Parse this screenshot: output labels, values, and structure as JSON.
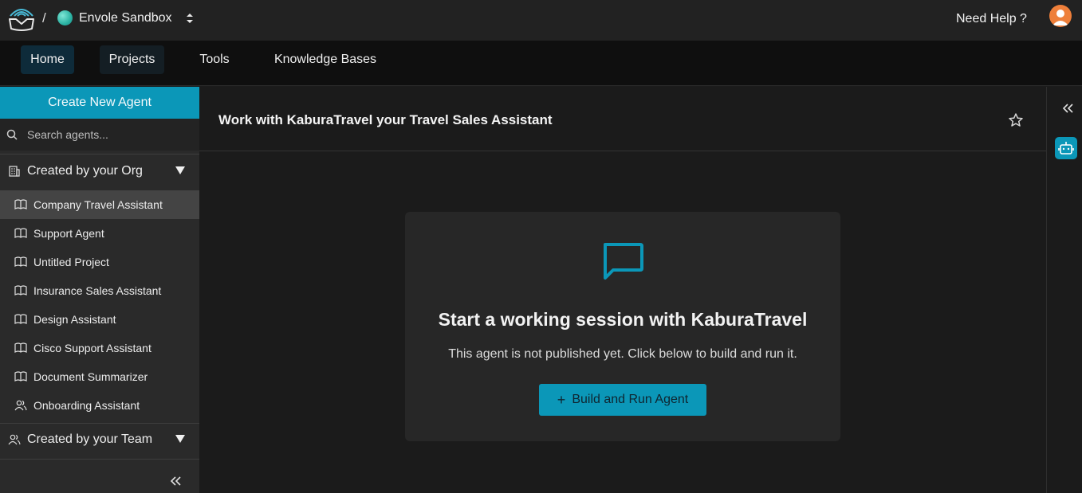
{
  "header": {
    "separator": "/",
    "workspace_name": "Envole Sandbox",
    "help_label": "Need Help ?"
  },
  "nav": {
    "tabs": [
      {
        "label": "Home",
        "active": true
      },
      {
        "label": "Projects"
      },
      {
        "label": "Tools"
      },
      {
        "label": "Knowledge Bases"
      }
    ]
  },
  "sidebar": {
    "create_label": "Create New Agent",
    "search_placeholder": "Search agents...",
    "org_group_label": "Created by your Org",
    "team_group_label": "Created by your Team",
    "items": [
      {
        "label": "Company Travel Assistant",
        "icon": "book-icon",
        "active": true
      },
      {
        "label": "Support Agent",
        "icon": "book-icon"
      },
      {
        "label": "Untitled Project",
        "icon": "book-icon"
      },
      {
        "label": "Insurance Sales Assistant",
        "icon": "book-icon"
      },
      {
        "label": "Design Assistant",
        "icon": "book-icon"
      },
      {
        "label": "Cisco Support Assistant",
        "icon": "book-icon"
      },
      {
        "label": "Document Summarizer",
        "icon": "book-icon"
      },
      {
        "label": "Onboarding Assistant",
        "icon": "users-icon"
      }
    ]
  },
  "main": {
    "title": "Work with KaburaTravel your Travel Sales Assistant",
    "card_title": "Start a working session with KaburaTravel",
    "card_subtitle": "This agent is not published yet. Click below to build and run it.",
    "build_button_label": "Build and Run Agent"
  },
  "colors": {
    "accent": "#0b97b8",
    "topbar": "#222222",
    "navbar": "#0f0f0f",
    "sidebar": "#2a2a2a",
    "main_bg": "#1b1b1b",
    "card_bg": "#272727"
  }
}
